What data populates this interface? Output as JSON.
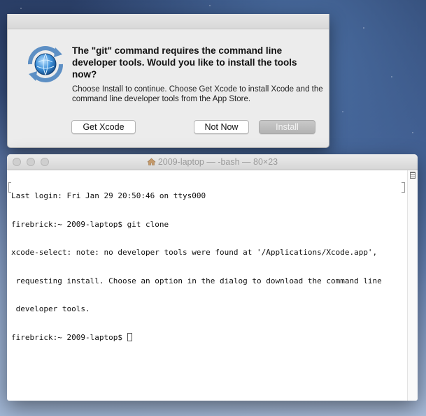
{
  "dialog": {
    "title": "The \"git\" command requires the command line developer tools. Would you like to install the tools now?",
    "message": "Choose Install to continue. Choose Get Xcode to install Xcode and the command line developer tools from the App Store.",
    "buttons": {
      "get_xcode": "Get Xcode",
      "not_now": "Not Now",
      "install": "Install"
    },
    "icon": "software-update-icon"
  },
  "terminal": {
    "title": "2009-laptop — -bash — 80×23",
    "title_icon": "house-icon",
    "lines": [
      "Last login: Fri Jan 29 20:50:46 on ttys000",
      "firebrick:~ 2009-laptop$ git clone",
      "xcode-select: note: no developer tools were found at '/Applications/Xcode.app',",
      " requesting install. Choose an option in the dialog to download the command line",
      " developer tools.",
      "firebrick:~ 2009-laptop$ "
    ]
  },
  "colors": {
    "install_button": "#b8b8b8",
    "dialog_bg": "#ececec",
    "desktop_top": "#2a3e66",
    "desktop_bottom": "#a9bcd9"
  }
}
